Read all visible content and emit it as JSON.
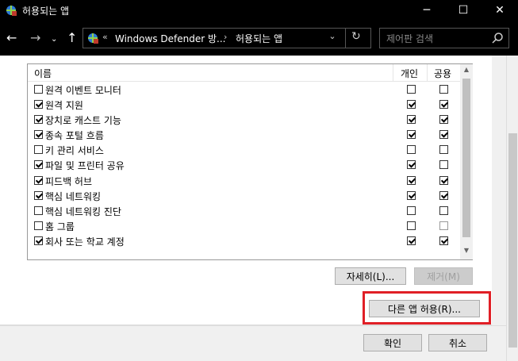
{
  "window": {
    "title": "허용되는 앱",
    "minimize": "─",
    "maximize": "☐",
    "close": "✕"
  },
  "nav": {
    "back": "←",
    "forward": "→",
    "recent": "⌄",
    "up": "↑",
    "address_chevron": "«",
    "crumb1": "Windows Defender 방...",
    "crumb_sep": "›",
    "crumb2": "허용되는 앱",
    "address_dropdown": "⌄",
    "refresh": "↻",
    "search_placeholder": "제어판 검색"
  },
  "list": {
    "col_name": "이름",
    "col_private": "개인",
    "col_public": "공용",
    "scroll_up": "▲",
    "scroll_down": "▼",
    "rows": [
      {
        "name": "원격 이벤트 모니터",
        "enabled": false,
        "private": false,
        "public": false
      },
      {
        "name": "원격 지원",
        "enabled": true,
        "private": true,
        "public": true
      },
      {
        "name": "장치로 캐스트 기능",
        "enabled": true,
        "private": true,
        "public": true
      },
      {
        "name": "종속 포털 흐름",
        "enabled": true,
        "private": true,
        "public": true
      },
      {
        "name": "키 관리 서비스",
        "enabled": false,
        "private": false,
        "public": false
      },
      {
        "name": "파일 및 프린터 공유",
        "enabled": true,
        "private": true,
        "public": false
      },
      {
        "name": "피드백 허브",
        "enabled": true,
        "private": true,
        "public": true
      },
      {
        "name": "핵심 네트워킹",
        "enabled": true,
        "private": true,
        "public": true
      },
      {
        "name": "핵심 네트워킹 진단",
        "enabled": false,
        "private": false,
        "public": false
      },
      {
        "name": "홈 그룹",
        "enabled": false,
        "private": false,
        "public": false,
        "public_dim": true
      },
      {
        "name": "회사 또는 학교 계정",
        "enabled": true,
        "private": true,
        "public": true
      }
    ]
  },
  "buttons": {
    "details": "자세히(L)...",
    "remove": "제거(M)",
    "allow_other": "다른 앱 허용(R)...",
    "ok": "확인",
    "cancel": "취소"
  },
  "colors": {
    "highlight": "#e01f26"
  }
}
